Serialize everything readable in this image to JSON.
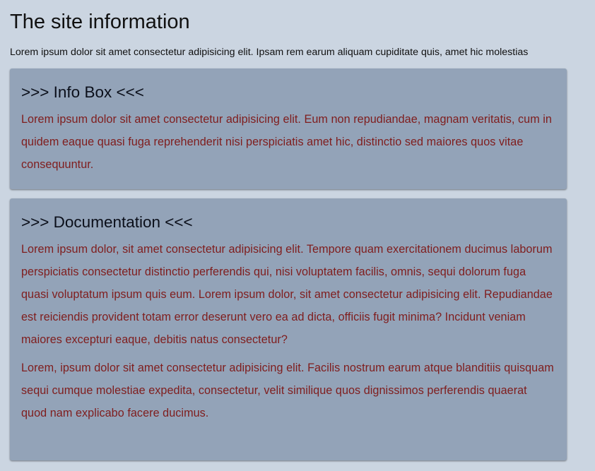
{
  "page": {
    "title": "The site information",
    "intro": "Lorem ipsum dolor sit amet consectetur adipisicing elit. Ipsam rem earum aliquam cupiditate quis, amet hic molestias"
  },
  "cards": [
    {
      "heading": ">>> Info Box <<<",
      "paragraphs": [
        "Lorem ipsum dolor sit amet consectetur adipisicing elit. Eum non repudiandae, magnam veritatis, cum in quidem eaque quasi fuga reprehenderit nisi perspiciatis amet hic, distinctio sed maiores quos vitae consequuntur."
      ]
    },
    {
      "heading": ">>> Documentation <<<",
      "paragraphs": [
        "Lorem ipsum dolor, sit amet consectetur adipisicing elit. Tempore quam exercitationem ducimus laborum perspiciatis consectetur distinctio perferendis qui, nisi voluptatem facilis, omnis, sequi dolorum fuga quasi voluptatum ipsum quis eum. Lorem ipsum dolor, sit amet consectetur adipisicing elit. Repudiandae est reiciendis provident totam error deserunt vero ea ad dicta, officiis fugit minima? Incidunt veniam maiores excepturi eaque, debitis natus consectetur?",
        "Lorem, ipsum dolor sit amet consectetur adipisicing elit. Facilis nostrum earum atque blanditiis quisquam sequi cumque molestiae expedita, consectetur, velit similique quos dignissimos perferendis quaerat quod nam explicabo facere ducimus."
      ]
    }
  ],
  "colors": {
    "background": "#cbd5e1",
    "card": "#93a3b8",
    "body_text": "#7f1d1d",
    "heading_text": "#0b0f1a"
  }
}
